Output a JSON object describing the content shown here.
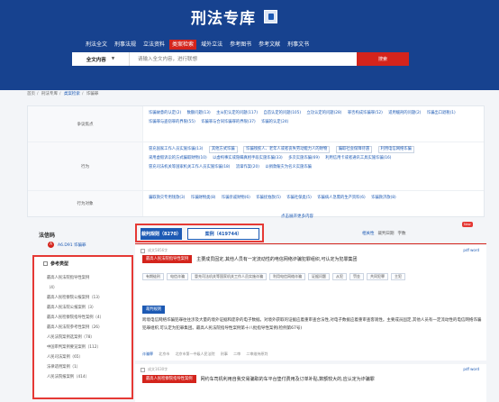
{
  "header": {
    "logo_text": "刑法专库",
    "nav": [
      "刑法全文",
      "刑事法规",
      "立法资料",
      "类案检索",
      "域外立法",
      "参考图书",
      "参考文献",
      "刑事文书"
    ],
    "nav_active_index": 3,
    "search": {
      "select_value": "全文内容",
      "placeholder": "请输入全文内容，进行联想",
      "button_label": "搜索"
    }
  },
  "breadcrumb": [
    "首页",
    "刑法专库",
    "类案检索",
    "诈骗罪"
  ],
  "filters": [
    {
      "label": "争议焦点",
      "values": [
        "诈骗故意的认定(2)",
        "数额问题(13)",
        "主从犯认定的问题(117)",
        "自首认定的问题(105)",
        "立功认定的问题(28)",
        "罪否构成诈骗罪(52)",
        "适用缓刑的问题(2)",
        "诈骗出口退税(1)",
        "诈骗罪与盗窃罪的界限(55)",
        "诈骗罪与合同诈骗罪的界限(37)",
        "诈骗的认定(24)"
      ]
    },
    {
      "label": "行为",
      "values": [
        "冒充国家工作人员实施诈骗(13)",
        "其他方式诈骗",
        "诈骗残疾人、老年人或者丧失劳动能力人的财物",
        "骗取社会保障待遇",
        "利用电信网络诈骗",
        "采用虚假诉讼的方式骗取财物(10)",
        "以虚构事实或隐瞒真相手段实施诈骗(33)",
        "多次实施诈骗(69)",
        "利用信用卡或者通讯工具实施诈骗(16)",
        "冒充司法机关等国家机关工作人员实施诈骗(18)",
        "流窜作案(20)",
        "以捐款赈灾为名义实施诈骗"
      ]
    },
    {
      "label": "行为对象",
      "values": [
        "骗取救灾专用钱款(3)",
        "诈骗财物类(8)",
        "诈骗亲戚财物(6)",
        "诈骗抚恤款(5)",
        "诈骗社保类(5)",
        "诈骗病人急需的生产资料(6)",
        "诈骗救济款(8)"
      ]
    }
  ],
  "expand_label": "点击展开更多内容",
  "sidebar": {
    "law_basis_title": "法信码",
    "law_code": "A6.D91 诈骗罪",
    "law_icon_glyph": "A",
    "ref_title": "参考类型",
    "ref_items": [
      "最高人民法院指导性案例",
      "（4）",
      "最高人民检察院公报案例（13）",
      "最高人民法院公报案例（3）",
      "最高人民检察院指导性案例（4）",
      "最高人民法院参考性案例（26）",
      "人民法院案例选案例（78）",
      "中国审判案例要览案例（112）",
      "人民司法案例（65）",
      "法律适用案例（1）",
      "人民法院报案例（414）"
    ]
  },
  "results": {
    "tabs": [
      "裁判规则（8270）",
      "案例（419744）"
    ],
    "toolbar": {
      "relevance_label": "相关性",
      "sort_label": "裁判日期",
      "word_count_label": "字数",
      "new_badge": "New"
    },
    "cards": [
      {
        "head": "成文5856字",
        "actions": "pdf  word",
        "title_badge": "最高人民法院指导性案例",
        "title": "主要成员固定,其他人员有一定流动性的电信网络诈骗犯罪组织,可认定为犯罪集团",
        "tags": [
          "有期徒刑",
          "电信诈骗",
          "冒充司法机关等国家机关工作人员实施诈骗",
          "利用电信网络诈骗",
          "证据问题",
          "从犯",
          "罚金",
          "共同犯罪",
          "主犯"
        ],
        "rule_badge": "裁判规则",
        "body": "跨境电信网络诈骗犯罪往往涉及大量的境外证据和庞杂的电子数据。对境外获取的证据应着重审查合法性,对电子数据应着重审查客观性。主要成员固定,其他人员有一定流动性的电信网络诈骗犯罪组织,可认定为犯罪集团。最高人民法院指导性案例第十八批指导性案例(检例第67号)",
        "meta": [
          "诈骗罪",
          "北京市",
          "北京市第一中级人民法院",
          "刑事",
          "二审",
          "二审维持原判"
        ]
      },
      {
        "head": "成文1630字",
        "actions": "pdf  word",
        "title_badge": "最高人民检察院指导性案例",
        "title": "网约车司机利用自我交易骗取的车平台垫付费用及订单补贴,数额较大的,应认定为诈骗罪"
      }
    ]
  }
}
